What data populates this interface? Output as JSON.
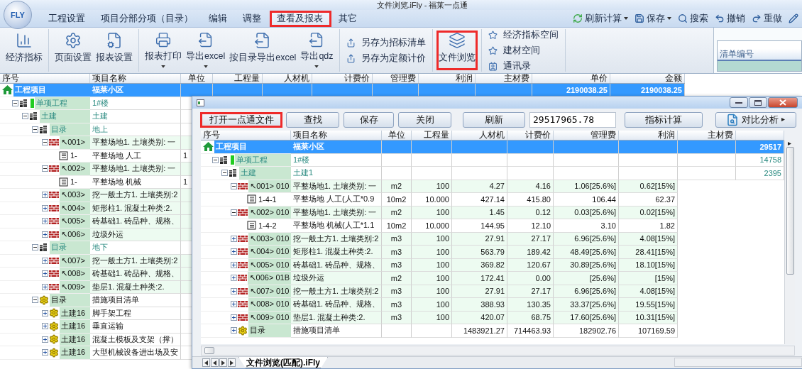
{
  "app": {
    "title": "文件浏览.iFly - 福莱一点通",
    "logo": "FLY"
  },
  "menu_tabs": [
    {
      "label": "工程设置",
      "selected": false,
      "highlighted": false
    },
    {
      "label": "项目分部分项（目录）",
      "selected": false,
      "highlighted": false
    },
    {
      "label": "编辑",
      "selected": false,
      "highlighted": false
    },
    {
      "label": "调整",
      "selected": false,
      "highlighted": false
    },
    {
      "label": "查看及报表",
      "selected": true,
      "highlighted": true
    },
    {
      "label": "其它",
      "selected": false,
      "highlighted": false
    }
  ],
  "quick_actions": [
    {
      "kind": "refresh",
      "label": "刷新计算",
      "dropdown": true
    },
    {
      "kind": "save",
      "label": "保存",
      "dropdown": true
    },
    {
      "kind": "search",
      "label": "搜索",
      "dropdown": false
    },
    {
      "kind": "undo",
      "label": "撤销",
      "dropdown": false
    },
    {
      "kind": "redo",
      "label": "重做",
      "dropdown": false
    },
    {
      "kind": "edit",
      "dropdown": false
    }
  ],
  "ribbon": [
    {
      "kind": "large",
      "items": [
        {
          "kind": "chart",
          "label": "经济指标",
          "dropdown": false,
          "highlighted": false
        }
      ]
    },
    {
      "kind": "large",
      "items": [
        {
          "kind": "page_setup",
          "label": "页面设置",
          "dropdown": false,
          "highlighted": false
        },
        {
          "kind": "report_setup",
          "label": "报表设置",
          "dropdown": false,
          "highlighted": false
        }
      ]
    },
    {
      "kind": "large",
      "items": [
        {
          "kind": "print",
          "label": "报表打印",
          "dropdown": true,
          "highlighted": false
        },
        {
          "kind": "export",
          "label": "导出excel",
          "dropdown": true,
          "highlighted": false
        },
        {
          "kind": "export",
          "label": "按目录导出excel",
          "dropdown": false,
          "highlighted": false
        },
        {
          "kind": "export",
          "label": "导出qdz",
          "dropdown": true,
          "highlighted": false
        }
      ]
    },
    {
      "kind": "small",
      "items": [
        {
          "kind": "save_as",
          "label": "另存为招标清单"
        },
        {
          "kind": "save_as",
          "label": "另存为定额计价"
        }
      ]
    },
    {
      "kind": "large",
      "items": [
        {
          "kind": "browse",
          "label": "文件浏览",
          "dropdown": false,
          "highlighted": true
        }
      ]
    },
    {
      "kind": "small",
      "items": [
        {
          "kind": "star",
          "label": "经济指标空间"
        },
        {
          "kind": "star",
          "label": "建材空间"
        },
        {
          "kind": "contacts",
          "label": "通讯录"
        }
      ]
    }
  ],
  "side_panel": {
    "header": "清单编号"
  },
  "grid": {
    "columns": [
      "序号",
      "项目名称",
      "单位",
      "工程量",
      "人材机",
      "计费价",
      "管理费",
      "利润",
      "主材费",
      "单价",
      "金额"
    ],
    "rows": [
      {
        "kind": "project",
        "selected": true,
        "cells": [
          "工程项目",
          "福莱小区",
          "",
          "",
          "",
          "",
          "",
          "",
          "",
          "2190038.25",
          "2190038.25"
        ],
        "children": [
          {
            "kind": "single",
            "selected": false,
            "expanded": true,
            "cells": [
              "单项工程",
              "1#楼"
            ],
            "children": [
              {
                "kind": "unit",
                "selected": false,
                "expanded": true,
                "cells": [
                  "土建",
                  "土建"
                ],
                "children": [
                  {
                    "kind": "folder",
                    "selected": false,
                    "expanded": true,
                    "cells": [
                      "目录",
                      "地上"
                    ],
                    "children": [
                      {
                        "kind": "item",
                        "selected": false,
                        "expanded": true,
                        "cells": [
                          "↖001>",
                          "平整场地1. 土壤类别: 一"
                        ],
                        "children": [
                          {
                            "kind": "sub",
                            "selected": false,
                            "cells": [
                              "1-",
                              "平整场地 人工",
                              "1"
                            ]
                          }
                        ]
                      },
                      {
                        "kind": "item",
                        "selected": false,
                        "expanded": true,
                        "cells": [
                          "↖002>",
                          "平整场地1. 土壤类别: 一"
                        ],
                        "children": [
                          {
                            "kind": "sub",
                            "selected": false,
                            "cells": [
                              "1-",
                              "平整场地 机械",
                              "1"
                            ]
                          }
                        ]
                      },
                      {
                        "kind": "item",
                        "selected": false,
                        "expanded": false,
                        "cells": [
                          "↖003>",
                          "挖一般土方1. 土壤类别:2"
                        ]
                      },
                      {
                        "kind": "item",
                        "selected": false,
                        "expanded": false,
                        "cells": [
                          "↖004>",
                          "矩形柱1. 混凝土种类:2."
                        ]
                      },
                      {
                        "kind": "item",
                        "selected": false,
                        "expanded": false,
                        "cells": [
                          "↖005>",
                          "砖基础1. 砖品种、规格、"
                        ]
                      },
                      {
                        "kind": "item",
                        "selected": false,
                        "expanded": false,
                        "cells": [
                          "↖006>",
                          "垃圾外运"
                        ]
                      }
                    ]
                  },
                  {
                    "kind": "folder",
                    "selected": false,
                    "expanded": true,
                    "cells": [
                      "目录",
                      "地下"
                    ],
                    "children": [
                      {
                        "kind": "item",
                        "selected": false,
                        "expanded": false,
                        "cells": [
                          "↖007>",
                          "挖一般土方1. 土壤类别:2"
                        ]
                      },
                      {
                        "kind": "item",
                        "selected": false,
                        "expanded": false,
                        "cells": [
                          "↖008>",
                          "砖基础1. 砖品种、规格、"
                        ]
                      },
                      {
                        "kind": "item",
                        "selected": false,
                        "expanded": false,
                        "cells": [
                          "↖009>",
                          "垫层1. 混凝土种类:2."
                        ]
                      }
                    ]
                  },
                  {
                    "kind": "measure",
                    "selected": false,
                    "expanded": true,
                    "cells": [
                      "目录",
                      "措施项目清单"
                    ],
                    "children": [
                      {
                        "kind": "measure_item",
                        "selected": false,
                        "expanded": false,
                        "cells": [
                          "土建16",
                          "脚手架工程"
                        ]
                      },
                      {
                        "kind": "measure_item",
                        "selected": false,
                        "expanded": false,
                        "cells": [
                          "土建16",
                          "垂直运输"
                        ]
                      },
                      {
                        "kind": "measure_item",
                        "selected": false,
                        "expanded": false,
                        "cells": [
                          "土建16",
                          "混凝土模板及支架（撑）"
                        ]
                      },
                      {
                        "kind": "measure_item",
                        "selected": false,
                        "expanded": false,
                        "cells": [
                          "土建16",
                          "大型机械设备进出场及安"
                        ]
                      }
                    ]
                  }
                ]
              }
            ]
          }
        ]
      }
    ]
  },
  "file_window": {
    "toolbar": [
      {
        "kind": "button",
        "label": "打开一点通文件",
        "highlighted": true
      },
      {
        "kind": "button",
        "label": "查找",
        "highlighted": false
      },
      {
        "kind": "button",
        "label": "保存",
        "highlighted": false
      },
      {
        "kind": "button",
        "label": "关闭",
        "highlighted": false
      },
      {
        "kind": "button",
        "label": "刷新",
        "highlighted": false
      },
      {
        "kind": "field",
        "value": "29517965.78",
        "highlighted": false
      },
      {
        "kind": "button",
        "label": "指标计算",
        "highlighted": false
      },
      {
        "kind": "menu",
        "label": "对比分析",
        "highlighted": false
      }
    ],
    "grid": {
      "columns": [
        "序号",
        "项目名称",
        "单位",
        "工程量",
        "人材机",
        "计费价",
        "管理费",
        "利润",
        "主材费"
      ],
      "rows": [
        {
          "kind": "project",
          "selected": true,
          "cells": [
            "工程项目",
            "福莱小区",
            "",
            "",
            "",
            "",
            "",
            "",
            "",
            "29517"
          ],
          "children": [
            {
              "kind": "single",
              "selected": false,
              "expanded": true,
              "cells": [
                "单项工程",
                "1#楼",
                "",
                "",
                "",
                "",
                "",
                "",
                "",
                "14758"
              ],
              "children": [
                {
                  "kind": "unit",
                  "selected": false,
                  "expanded": true,
                  "cells": [
                    "土建",
                    "土建1",
                    "",
                    "",
                    "",
                    "",
                    "",
                    "",
                    "",
                    "2395"
                  ],
                  "children": [
                    {
                      "kind": "item",
                      "selected": false,
                      "expanded": true,
                      "cells": [
                        "↖001> 010",
                        "平整场地1. 土壤类别: 一",
                        "m2",
                        "100",
                        "4.27",
                        "4.16",
                        "1.06[25.6%]",
                        "0.62[15%]"
                      ],
                      "children": [
                        {
                          "kind": "sub",
                          "selected": false,
                          "cells": [
                            "1-4-1",
                            "平整场地 人工(人工*0.9",
                            "10m2",
                            "10.000",
                            "427.14",
                            "415.80",
                            "106.44",
                            "62.37"
                          ]
                        }
                      ]
                    },
                    {
                      "kind": "item",
                      "selected": false,
                      "expanded": true,
                      "cells": [
                        "↖002> 010",
                        "平整场地1. 土壤类别: 一",
                        "m2",
                        "100",
                        "1.45",
                        "0.12",
                        "0.03[25.6%]",
                        "0.02[15%]"
                      ],
                      "children": [
                        {
                          "kind": "sub",
                          "selected": false,
                          "cells": [
                            "1-4-2",
                            "平整场地 机械(人工*1.1",
                            "10m2",
                            "10.000",
                            "144.95",
                            "12.10",
                            "3.10",
                            "1.82"
                          ]
                        }
                      ]
                    },
                    {
                      "kind": "item",
                      "selected": false,
                      "expanded": false,
                      "cells": [
                        "↖003> 010",
                        "挖一般土方1. 土壤类别:2",
                        "m3",
                        "100",
                        "27.91",
                        "27.17",
                        "6.96[25.6%]",
                        "4.08[15%]"
                      ]
                    },
                    {
                      "kind": "item",
                      "selected": false,
                      "expanded": false,
                      "cells": [
                        "↖004> 010",
                        "矩形柱1. 混凝土种类:2.",
                        "m3",
                        "100",
                        "563.79",
                        "189.42",
                        "48.49[25.6%]",
                        "28.41[15%]"
                      ]
                    },
                    {
                      "kind": "item",
                      "selected": false,
                      "expanded": false,
                      "cells": [
                        "↖005> 010",
                        "砖基础1. 砖品种、规格、",
                        "m3",
                        "100",
                        "369.82",
                        "120.67",
                        "30.89[25.6%]",
                        "18.10[15%]"
                      ]
                    },
                    {
                      "kind": "item",
                      "selected": false,
                      "expanded": false,
                      "cells": [
                        "↖006> 01B",
                        "垃圾外运",
                        "m2",
                        "100",
                        "172.41",
                        "0.00",
                        "[25.6%]",
                        "[15%]"
                      ]
                    },
                    {
                      "kind": "item",
                      "selected": false,
                      "expanded": false,
                      "cells": [
                        "↖007> 010",
                        "挖一般土方1. 土壤类别:2",
                        "m3",
                        "100",
                        "27.91",
                        "27.17",
                        "6.96[25.6%]",
                        "4.08[15%]"
                      ]
                    },
                    {
                      "kind": "item",
                      "selected": false,
                      "expanded": false,
                      "cells": [
                        "↖008> 010",
                        "砖基础1. 砖品种、规格、",
                        "m3",
                        "100",
                        "388.93",
                        "130.35",
                        "33.37[25.6%]",
                        "19.55[15%]"
                      ]
                    },
                    {
                      "kind": "item",
                      "selected": false,
                      "expanded": false,
                      "cells": [
                        "↖009> 010",
                        "垫层1. 混凝土种类:2.",
                        "m3",
                        "100",
                        "420.07",
                        "68.75",
                        "17.60[25.6%]",
                        "10.31[15%]"
                      ]
                    },
                    {
                      "kind": "measure",
                      "selected": false,
                      "expanded": false,
                      "cells": [
                        "目录",
                        "措施项目清单",
                        "",
                        "",
                        "1483921.27",
                        "714463.93",
                        "182902.76",
                        "107169.59"
                      ]
                    }
                  ]
                }
              ]
            }
          ]
        }
      ]
    },
    "sheet_tabs": [
      {
        "label": "文件浏览(匹配).iFly",
        "selected": true
      }
    ]
  }
}
